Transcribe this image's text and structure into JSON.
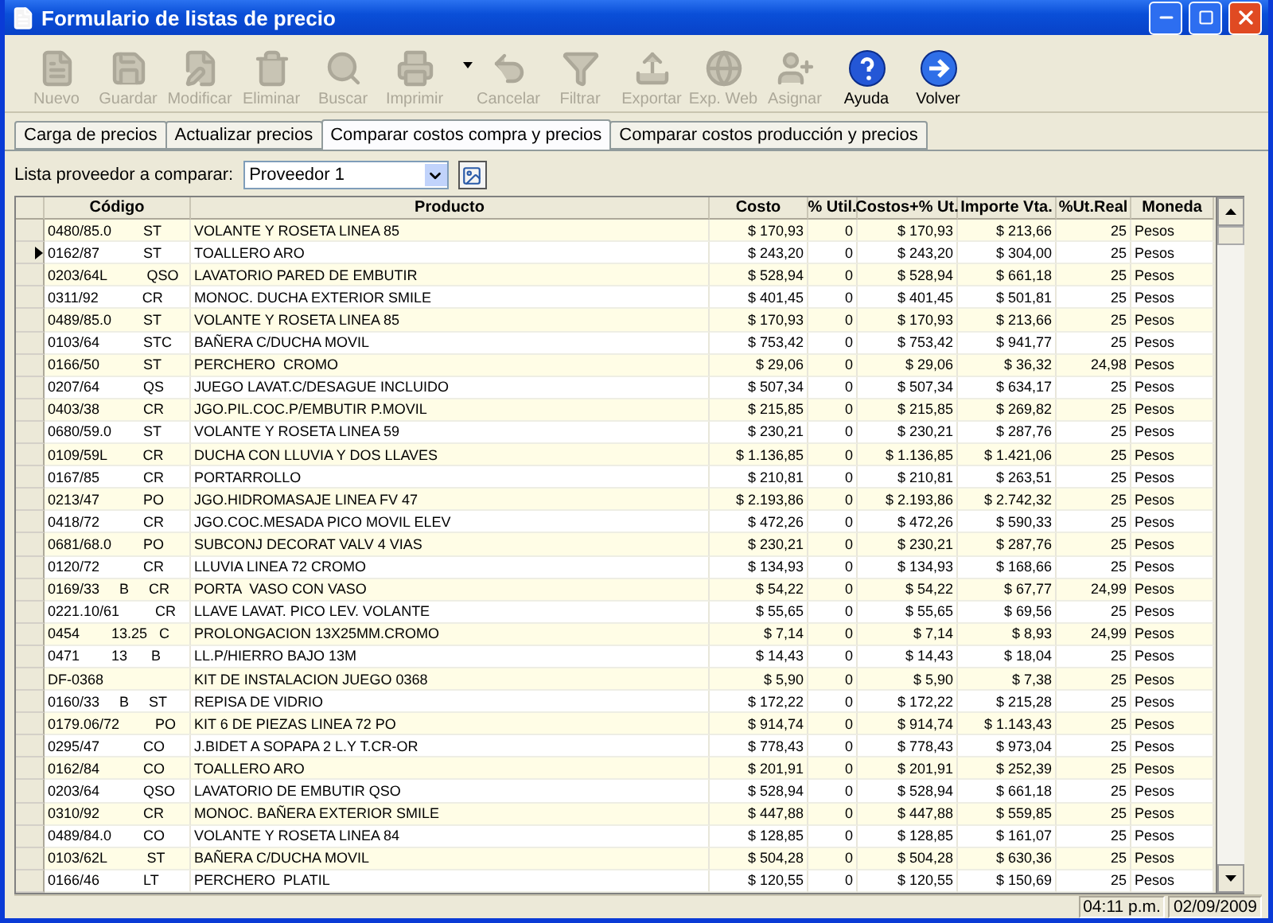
{
  "window": {
    "title": "Formulario de listas de precio"
  },
  "toolbar": [
    {
      "label": "Nuevo",
      "kind": "new",
      "disabled": true
    },
    {
      "label": "Guardar",
      "kind": "save",
      "disabled": true
    },
    {
      "label": "Modificar",
      "kind": "edit",
      "disabled": true
    },
    {
      "label": "Eliminar",
      "kind": "delete",
      "disabled": true
    },
    {
      "label": "Buscar",
      "kind": "search",
      "disabled": true
    },
    {
      "label": "Imprimir",
      "kind": "print",
      "disabled": true
    },
    {
      "label": "Cancelar",
      "kind": "cancel",
      "disabled": true
    },
    {
      "label": "Filtrar",
      "kind": "filter",
      "disabled": true
    },
    {
      "label": "Exportar",
      "kind": "export",
      "disabled": true
    },
    {
      "label": "Exp. Web",
      "kind": "web",
      "disabled": true
    },
    {
      "label": "Asignar",
      "kind": "assign",
      "disabled": true
    },
    {
      "label": "Ayuda",
      "kind": "help",
      "disabled": false
    },
    {
      "label": "Volver",
      "kind": "back",
      "disabled": false
    }
  ],
  "tabs": [
    {
      "label": "Carga de precios",
      "selected": false
    },
    {
      "label": "Actualizar precios",
      "selected": false
    },
    {
      "label": "Comparar costos compra y precios",
      "selected": true
    },
    {
      "label": "Comparar costos producción y precios",
      "selected": false
    }
  ],
  "supplier_select": {
    "label": "Lista proveedor a comparar:",
    "value": "Proveedor 1"
  },
  "table": {
    "columns": [
      "Código",
      "Producto",
      "Costo",
      "% Util.",
      "Costos+% Ut.",
      "Importe Vta.",
      "%Ut.Real",
      "Moneda"
    ],
    "rows": [
      {
        "selected": false,
        "cells": [
          "0480/85.0        ST",
          "VOLANTE Y ROSETA LINEA 85",
          "$ 170,93",
          "0",
          "$ 170,93",
          "$ 213,66",
          "25",
          "Pesos"
        ]
      },
      {
        "selected": true,
        "cells": [
          "0162/87           ST",
          "TOALLERO ARO",
          "$ 243,20",
          "0",
          "$ 243,20",
          "$ 304,00",
          "25",
          "Pesos"
        ]
      },
      {
        "selected": false,
        "cells": [
          "0203/64L          QSO",
          "LAVATORIO PARED DE EMBUTIR",
          "$ 528,94",
          "0",
          "$ 528,94",
          "$ 661,18",
          "25",
          "Pesos"
        ]
      },
      {
        "selected": false,
        "cells": [
          "0311/92           CR",
          "MONOC. DUCHA EXTERIOR SMILE",
          "$ 401,45",
          "0",
          "$ 401,45",
          "$ 501,81",
          "25",
          "Pesos"
        ]
      },
      {
        "selected": false,
        "cells": [
          "0489/85.0        ST",
          "VOLANTE Y ROSETA LINEA 85",
          "$ 170,93",
          "0",
          "$ 170,93",
          "$ 213,66",
          "25",
          "Pesos"
        ]
      },
      {
        "selected": false,
        "cells": [
          "0103/64           STC",
          "BAÑERA C/DUCHA MOVIL",
          "$ 753,42",
          "0",
          "$ 753,42",
          "$ 941,77",
          "25",
          "Pesos"
        ]
      },
      {
        "selected": false,
        "cells": [
          "0166/50           ST",
          "PERCHERO  CROMO",
          "$ 29,06",
          "0",
          "$ 29,06",
          "$ 36,32",
          "24,98",
          "Pesos"
        ]
      },
      {
        "selected": false,
        "cells": [
          "0207/64           QS",
          "JUEGO LAVAT.C/DESAGUE INCLUIDO",
          "$ 507,34",
          "0",
          "$ 507,34",
          "$ 634,17",
          "25",
          "Pesos"
        ]
      },
      {
        "selected": false,
        "cells": [
          "0403/38           CR",
          "JGO.PIL.COC.P/EMBUTIR P.MOVIL",
          "$ 215,85",
          "0",
          "$ 215,85",
          "$ 269,82",
          "25",
          "Pesos"
        ]
      },
      {
        "selected": false,
        "cells": [
          "0680/59.0        ST",
          "VOLANTE Y ROSETA LINEA 59",
          "$ 230,21",
          "0",
          "$ 230,21",
          "$ 287,76",
          "25",
          "Pesos"
        ]
      },
      {
        "selected": false,
        "cells": [
          "0109/59L         CR",
          "DUCHA CON LLUVIA Y DOS LLAVES",
          "$ 1.136,85",
          "0",
          "$ 1.136,85",
          "$ 1.421,06",
          "25",
          "Pesos"
        ]
      },
      {
        "selected": false,
        "cells": [
          "0167/85           CR",
          "PORTARROLLO",
          "$ 210,81",
          "0",
          "$ 210,81",
          "$ 263,51",
          "25",
          "Pesos"
        ]
      },
      {
        "selected": false,
        "cells": [
          "0213/47           PO",
          "JGO.HIDROMASAJE LINEA FV 47",
          "$ 2.193,86",
          "0",
          "$ 2.193,86",
          "$ 2.742,32",
          "25",
          "Pesos"
        ]
      },
      {
        "selected": false,
        "cells": [
          "0418/72           CR",
          "JGO.COC.MESADA PICO MOVIL ELEV",
          "$ 472,26",
          "0",
          "$ 472,26",
          "$ 590,33",
          "25",
          "Pesos"
        ]
      },
      {
        "selected": false,
        "cells": [
          "0681/68.0        PO",
          "SUBCONJ DECORAT VALV 4 VIAS",
          "$ 230,21",
          "0",
          "$ 230,21",
          "$ 287,76",
          "25",
          "Pesos"
        ]
      },
      {
        "selected": false,
        "cells": [
          "0120/72           CR",
          "LLUVIA LINEA 72 CROMO",
          "$ 134,93",
          "0",
          "$ 134,93",
          "$ 168,66",
          "25",
          "Pesos"
        ]
      },
      {
        "selected": false,
        "cells": [
          "0169/33     B     CR",
          "PORTA  VASO CON VASO",
          "$ 54,22",
          "0",
          "$ 54,22",
          "$ 67,77",
          "24,99",
          "Pesos"
        ]
      },
      {
        "selected": false,
        "cells": [
          "0221.10/61         CR",
          "LLAVE LAVAT. PICO LEV. VOLANTE",
          "$ 55,65",
          "0",
          "$ 55,65",
          "$ 69,56",
          "25",
          "Pesos"
        ]
      },
      {
        "selected": false,
        "cells": [
          "0454        13.25   C",
          "PROLONGACION 13X25MM.CROMO",
          "$ 7,14",
          "0",
          "$ 7,14",
          "$ 8,93",
          "24,99",
          "Pesos"
        ]
      },
      {
        "selected": false,
        "cells": [
          "0471        13      B",
          "LL.P/HIERRO BAJO 13M",
          "$ 14,43",
          "0",
          "$ 14,43",
          "$ 18,04",
          "25",
          "Pesos"
        ]
      },
      {
        "selected": false,
        "cells": [
          "DF-0368",
          "KIT DE INSTALACION JUEGO 0368",
          "$ 5,90",
          "0",
          "$ 5,90",
          "$ 7,38",
          "25",
          "Pesos"
        ]
      },
      {
        "selected": false,
        "cells": [
          "0160/33     B     ST",
          "REPISA DE VIDRIO",
          "$ 172,22",
          "0",
          "$ 172,22",
          "$ 215,28",
          "25",
          "Pesos"
        ]
      },
      {
        "selected": false,
        "cells": [
          "0179.06/72         PO",
          "KIT 6 DE PIEZAS LINEA 72 PO",
          "$ 914,74",
          "0",
          "$ 914,74",
          "$ 1.143,43",
          "25",
          "Pesos"
        ]
      },
      {
        "selected": false,
        "cells": [
          "0295/47           CO",
          "J.BIDET A SOPAPA 2 L.Y T.CR-OR",
          "$ 778,43",
          "0",
          "$ 778,43",
          "$ 973,04",
          "25",
          "Pesos"
        ]
      },
      {
        "selected": false,
        "cells": [
          "0162/84           CO",
          "TOALLERO ARO",
          "$ 201,91",
          "0",
          "$ 201,91",
          "$ 252,39",
          "25",
          "Pesos"
        ]
      },
      {
        "selected": false,
        "cells": [
          "0203/64           QSO",
          "LAVATORIO DE EMBUTIR QSO",
          "$ 528,94",
          "0",
          "$ 528,94",
          "$ 661,18",
          "25",
          "Pesos"
        ]
      },
      {
        "selected": false,
        "cells": [
          "0310/92           CR",
          "MONOC. BAÑERA EXTERIOR SMILE",
          "$ 447,88",
          "0",
          "$ 447,88",
          "$ 559,85",
          "25",
          "Pesos"
        ]
      },
      {
        "selected": false,
        "cells": [
          "0489/84.0        CO",
          "VOLANTE Y ROSETA LINEA 84",
          "$ 128,85",
          "0",
          "$ 128,85",
          "$ 161,07",
          "25",
          "Pesos"
        ]
      },
      {
        "selected": false,
        "cells": [
          "0103/62L          ST",
          "BAÑERA C/DUCHA MOVIL",
          "$ 504,28",
          "0",
          "$ 504,28",
          "$ 630,36",
          "25",
          "Pesos"
        ]
      },
      {
        "selected": false,
        "cells": [
          "0166/46           LT",
          "PERCHERO  PLATIL",
          "$ 120,55",
          "0",
          "$ 120,55",
          "$ 150,69",
          "25",
          "Pesos"
        ]
      }
    ]
  },
  "status_bar": {
    "time": "04:11 p.m.",
    "date": "02/09/2009"
  }
}
